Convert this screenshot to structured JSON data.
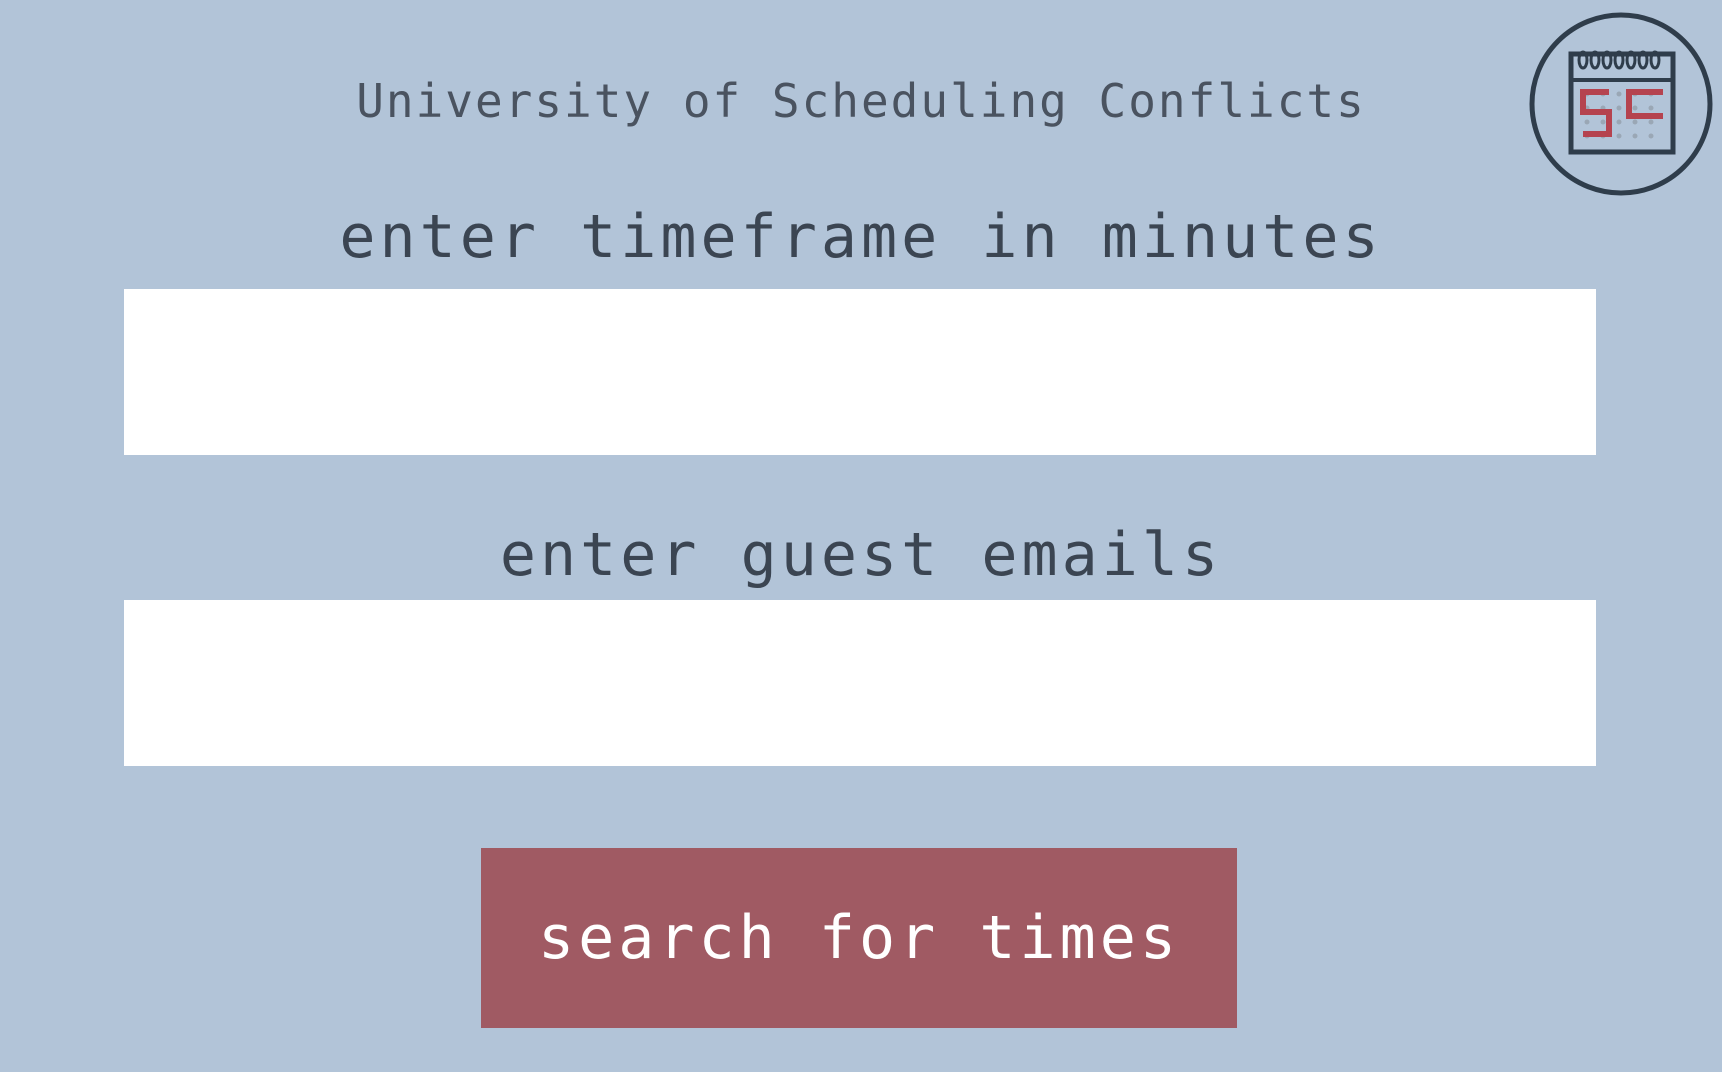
{
  "header": {
    "title": "University of Scheduling Conflicts",
    "logo_icon": "calendar-logo-icon"
  },
  "form": {
    "timeframe": {
      "label": "enter timeframe in minutes",
      "value": "",
      "placeholder": ""
    },
    "emails": {
      "label": "enter guest emails",
      "value": "",
      "placeholder": ""
    },
    "search_button_label": "search for times"
  },
  "colors": {
    "background": "#b2c4d8",
    "text": "#3b4552",
    "button": "#a05a63",
    "button_text": "#ffffff",
    "logo_accent": "#b5434f"
  }
}
